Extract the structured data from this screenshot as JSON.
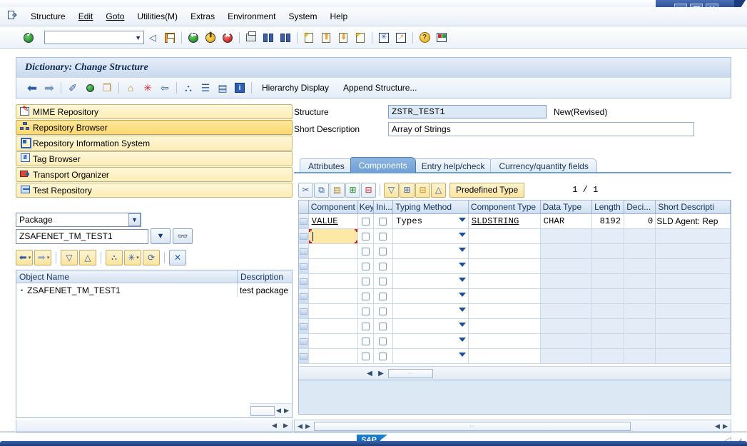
{
  "window": {
    "controls": [
      {
        "name": "minimize",
        "glyph": "–"
      },
      {
        "name": "maximize",
        "glyph": "□"
      },
      {
        "name": "close",
        "glyph": "✕"
      }
    ]
  },
  "menubar": {
    "system_icon": "⇨",
    "items": [
      {
        "label": "Structure",
        "accel": ""
      },
      {
        "label": "Edit",
        "accel": "E"
      },
      {
        "label": "Goto",
        "accel": "G"
      },
      {
        "label": "Utilities(M)",
        "accel": "M"
      },
      {
        "label": "Extras",
        "accel": "a"
      },
      {
        "label": "Environment",
        "accel": "n"
      },
      {
        "label": "System",
        "accel": "y"
      },
      {
        "label": "Help",
        "accel": "H"
      }
    ]
  },
  "apptoolbar": {
    "enter_icon": "check-green-icon",
    "command_field": {
      "value": "",
      "placeholder": ""
    },
    "buttons": [
      {
        "name": "back-arrow-icon",
        "glyph": "◁"
      },
      {
        "name": "save-disk-icon",
        "glyph": "💾"
      },
      {
        "name": "back-green-icon",
        "glyph": "⬅"
      },
      {
        "name": "exit-yellow-icon",
        "glyph": "⬆"
      },
      {
        "name": "cancel-red-icon",
        "glyph": "✖"
      },
      {
        "name": "print-icon",
        "glyph": "🖶"
      },
      {
        "name": "find-icon",
        "glyph": "🔍"
      },
      {
        "name": "find-next-icon",
        "glyph": "🔎"
      },
      {
        "name": "first-page-icon",
        "glyph": "⇱"
      },
      {
        "name": "prev-page-icon",
        "glyph": "⇧"
      },
      {
        "name": "next-page-icon",
        "glyph": "⇩"
      },
      {
        "name": "last-page-icon",
        "glyph": "⇲"
      },
      {
        "name": "new-session-icon",
        "glyph": "✳"
      },
      {
        "name": "create-shortcut-icon",
        "glyph": "↗"
      },
      {
        "name": "help-icon",
        "glyph": "?"
      },
      {
        "name": "layout-menu-icon",
        "glyph": "▤"
      }
    ]
  },
  "screen": {
    "title": "Dictionary: Change Structure"
  },
  "fntoolbar": {
    "icons": [
      {
        "name": "back-icon",
        "glyph": "⬅"
      },
      {
        "name": "forward-icon",
        "glyph": "➡"
      },
      {
        "name": "check-syntax-icon",
        "glyph": "✎"
      },
      {
        "name": "activate-icon",
        "glyph": "◉"
      },
      {
        "name": "copy-object-icon",
        "glyph": "❐"
      },
      {
        "name": "display-hierarchy-icon",
        "glyph": "⌂"
      },
      {
        "name": "wizard-icon",
        "glyph": "✳"
      },
      {
        "name": "expand-icon",
        "glyph": "⇔"
      },
      {
        "name": "structure-tree-icon",
        "glyph": "⛬"
      },
      {
        "name": "stack-icon",
        "glyph": "☰"
      },
      {
        "name": "list-icon",
        "glyph": "▤"
      },
      {
        "name": "info-icon",
        "glyph": "i"
      }
    ],
    "text_buttons": [
      {
        "label": "Hierarchy Display"
      },
      {
        "label": "Append Structure..."
      }
    ]
  },
  "sidebar": {
    "items": [
      {
        "label": "MIME Repository",
        "icon": "mime-repository-icon",
        "active": false
      },
      {
        "label": "Repository Browser",
        "icon": "repository-browser-icon",
        "active": true
      },
      {
        "label": "Repository Information System",
        "icon": "repository-info-system-icon",
        "active": false
      },
      {
        "label": "Tag Browser",
        "icon": "tag-browser-icon",
        "active": false
      },
      {
        "label": "Transport Organizer",
        "icon": "transport-organizer-icon",
        "active": false
      },
      {
        "label": "Test Repository",
        "icon": "test-repository-icon",
        "active": false
      }
    ],
    "object_type_select": {
      "value": "Package",
      "arrow": "▼"
    },
    "object_name_input": {
      "value": "ZSAFENET_TM_TEST1",
      "dropdown_arrow": "▼"
    },
    "binoculars_button": {
      "name": "search-object-icon",
      "glyph": "👓"
    },
    "nav_buttons": [
      {
        "name": "nav-back-button",
        "glyph": "⬅",
        "has_menu": true
      },
      {
        "name": "nav-forward-button",
        "glyph": "➡",
        "has_menu": true
      },
      {
        "name": "expand-all-button",
        "glyph": "▼"
      },
      {
        "name": "collapse-all-button",
        "glyph": "▲"
      },
      {
        "name": "object-list-button",
        "glyph": "⛬"
      },
      {
        "name": "other-object-button",
        "glyph": "✳",
        "has_menu": true
      },
      {
        "name": "refresh-button",
        "glyph": "⟳"
      },
      {
        "name": "close-list-button",
        "glyph": "✕"
      }
    ],
    "object_list": {
      "columns": [
        "Object Name",
        "Description"
      ],
      "rows": [
        {
          "bullet": "•",
          "name": "ZSAFENET_TM_TEST1",
          "description": "test package"
        }
      ]
    }
  },
  "main": {
    "fields": [
      {
        "label": "Structure",
        "value": "ZSTR_TEST1",
        "status": "New(Revised)"
      },
      {
        "label": "Short Description",
        "value": "Array of Strings",
        "status": ""
      }
    ],
    "tabs": [
      {
        "label": "Attributes",
        "active": false
      },
      {
        "label": "Components",
        "active": true
      },
      {
        "label": "Entry help/check",
        "active": false
      },
      {
        "label": "Currency/quantity fields",
        "active": false
      }
    ],
    "grid_toolbar": {
      "buttons": [
        {
          "name": "cut-icon",
          "glyph": "✂"
        },
        {
          "name": "copy-icon",
          "glyph": "⧉"
        },
        {
          "name": "paste-icon",
          "glyph": "📋"
        },
        {
          "name": "insert-row-icon",
          "glyph": "⊞"
        },
        {
          "name": "delete-row-icon",
          "glyph": "⊟"
        },
        {
          "name": "expand-include-icon",
          "glyph": "▼"
        },
        {
          "name": "append-row-icon",
          "glyph": "⊞"
        },
        {
          "name": "remove-row-icon",
          "glyph": "⊟"
        },
        {
          "name": "collapse-icon",
          "glyph": "▲"
        }
      ],
      "predefined_type_label": "Predefined Type",
      "counter": "1 / 1"
    },
    "grid": {
      "columns": [
        {
          "key": "component",
          "label": "Component"
        },
        {
          "key": "key",
          "label": "Key"
        },
        {
          "key": "ini",
          "label": "Ini..."
        },
        {
          "key": "typing_method",
          "label": "Typing Method"
        },
        {
          "key": "component_type",
          "label": "Component Type"
        },
        {
          "key": "data_type",
          "label": "Data Type"
        },
        {
          "key": "length",
          "label": "Length"
        },
        {
          "key": "decimals",
          "label": "Deci..."
        },
        {
          "key": "short_description",
          "label": "Short Descripti"
        }
      ],
      "rows": [
        {
          "component": "VALUE",
          "key": false,
          "ini": false,
          "typing_method": "Types",
          "component_type": "SLDSTRING",
          "data_type": "CHAR",
          "length": "8192",
          "decimals": "0",
          "short_description": "SLD Agent: Rep",
          "focused": false
        },
        {
          "component": "",
          "key": false,
          "ini": false,
          "typing_method": "",
          "component_type": "",
          "data_type": "",
          "length": "",
          "decimals": "",
          "short_description": "",
          "focused": true
        },
        {
          "component": "",
          "key": false,
          "ini": false,
          "typing_method": "",
          "component_type": "",
          "data_type": "",
          "length": "",
          "decimals": "",
          "short_description": "",
          "focused": false
        },
        {
          "component": "",
          "key": false,
          "ini": false,
          "typing_method": "",
          "component_type": "",
          "data_type": "",
          "length": "",
          "decimals": "",
          "short_description": "",
          "focused": false
        },
        {
          "component": "",
          "key": false,
          "ini": false,
          "typing_method": "",
          "component_type": "",
          "data_type": "",
          "length": "",
          "decimals": "",
          "short_description": "",
          "focused": false
        },
        {
          "component": "",
          "key": false,
          "ini": false,
          "typing_method": "",
          "component_type": "",
          "data_type": "",
          "length": "",
          "decimals": "",
          "short_description": "",
          "focused": false
        },
        {
          "component": "",
          "key": false,
          "ini": false,
          "typing_method": "",
          "component_type": "",
          "data_type": "",
          "length": "",
          "decimals": "",
          "short_description": "",
          "focused": false
        },
        {
          "component": "",
          "key": false,
          "ini": false,
          "typing_method": "",
          "component_type": "",
          "data_type": "",
          "length": "",
          "decimals": "",
          "short_description": "",
          "focused": false
        },
        {
          "component": "",
          "key": false,
          "ini": false,
          "typing_method": "",
          "component_type": "",
          "data_type": "",
          "length": "",
          "decimals": "",
          "short_description": "",
          "focused": false
        },
        {
          "component": "",
          "key": false,
          "ini": false,
          "typing_method": "",
          "component_type": "",
          "data_type": "",
          "length": "",
          "decimals": "",
          "short_description": "",
          "focused": false
        }
      ]
    }
  },
  "statusbar": {
    "logo": "SAP",
    "resize_grip": "◢"
  },
  "colors": {
    "accent_blue": "#1b3b79",
    "tab_active": "#6d9fd6",
    "sidebar_yellow": "#fcd871",
    "focus_yellow": "#fde9a5",
    "focus_border_red": "#d01c1c",
    "grid_row_blue": "#e4edf7",
    "sap_logo_blue": "#1a7fd4"
  }
}
